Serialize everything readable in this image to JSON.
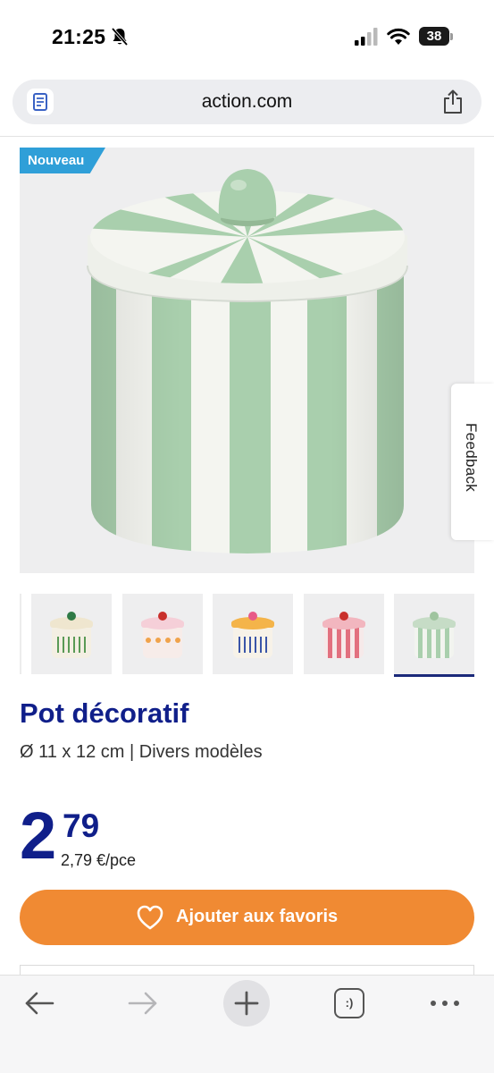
{
  "status_bar": {
    "time": "21:25",
    "battery": "38"
  },
  "address_bar": {
    "url": "action.com"
  },
  "product": {
    "badge": "Nouveau",
    "feedback_label": "Feedback",
    "title": "Pot décoratif",
    "subtitle": "Ø 11 x 12 cm | Divers modèles",
    "price_whole": "2",
    "price_cents": "79",
    "price_unit": "2,79 €/pce",
    "favorite_button": "Ajouter aux favoris"
  },
  "thumbnails": [
    {
      "variant": "cream-green-lines",
      "body": "#f4efe3",
      "lid": "#efe6cf",
      "knob": "#2f7a46",
      "accent": "#5a9a55",
      "selected": false
    },
    {
      "variant": "pink-dots",
      "body": "#f7ece9",
      "lid": "#f5cfd8",
      "knob": "#c9302c",
      "accent": "#f0a24a",
      "selected": false
    },
    {
      "variant": "yellow-lines",
      "body": "#f7f2e8",
      "lid": "#f4b44a",
      "knob": "#e85a87",
      "accent": "#3a55a8",
      "selected": false
    },
    {
      "variant": "pink-stripes",
      "body": "#f6e9e9",
      "lid": "#f2b6bf",
      "knob": "#c9302c",
      "accent": "#e2707f",
      "selected": false
    },
    {
      "variant": "green-stripes",
      "body": "#f2f4ef",
      "lid": "#c6dcc6",
      "knob": "#9fc49f",
      "accent": "#a9cfad",
      "selected": true
    }
  ],
  "colors": {
    "brand_blue": "#101f8a",
    "badge_blue": "#2f9fd8",
    "favorite_orange": "#f08a33",
    "stripe_green": "#a9cfad"
  },
  "toolbar": {
    "icons": [
      "back-arrow-icon",
      "forward-arrow-icon",
      "plus-icon",
      "tabs-icon",
      "more-icon"
    ],
    "tabs_label": ":)"
  }
}
